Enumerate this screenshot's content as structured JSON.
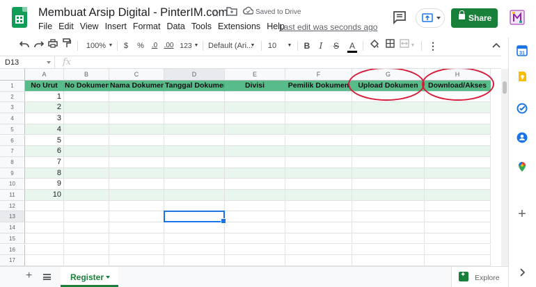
{
  "window": {
    "doc_title": "Membuat Arsip Digital - PinterIM.com",
    "saved_status": "Saved to Drive",
    "last_edit": "Last edit was seconds ago",
    "share_label": "Share"
  },
  "menu": [
    "File",
    "Edit",
    "View",
    "Insert",
    "Format",
    "Data",
    "Tools",
    "Extensions",
    "Help"
  ],
  "toolbar": {
    "zoom": "100%",
    "currency": "$",
    "percent": "%",
    "dec_decrease": ".0",
    "dec_increase": ".00",
    "more_formats": "123",
    "font": "Default (Ari...",
    "font_size": "10",
    "bold": "B",
    "italic": "I",
    "strike": "S",
    "text_color": "A",
    "more": "⋮",
    "text_color_hex": "#000000"
  },
  "formula_bar": {
    "name_box": "D13",
    "fx": "fx",
    "content": ""
  },
  "sheet": {
    "columns": [
      "A",
      "B",
      "C",
      "D",
      "E",
      "F",
      "G",
      "H"
    ],
    "rows": [
      "1",
      "2",
      "3",
      "4",
      "5",
      "6",
      "7",
      "8",
      "9",
      "10",
      "11",
      "12",
      "13",
      "14",
      "15",
      "16",
      "17"
    ],
    "headers": [
      "No Urut",
      "No Dokumen",
      "Nama Dokumen",
      "Tanggal Dokumen",
      "Divisi",
      "Pemilik Dokumen",
      "Upload Dokumen",
      "Download/Akses"
    ],
    "no_urut": [
      "1",
      "2",
      "3",
      "4",
      "5",
      "6",
      "7",
      "8",
      "9",
      "10"
    ],
    "active_cell": "D13",
    "header_fill": "#57bb8a",
    "band_fill": "#e8f6ee",
    "annotation_color": "#d81b3a"
  },
  "tabs": {
    "add_sheet": "+",
    "active_sheet": "Register",
    "explore": "Explore"
  },
  "side_panel": [
    "calendar-icon",
    "keep-icon",
    "tasks-icon",
    "contacts-icon",
    "maps-icon",
    "add-icon",
    "expand-icon"
  ]
}
